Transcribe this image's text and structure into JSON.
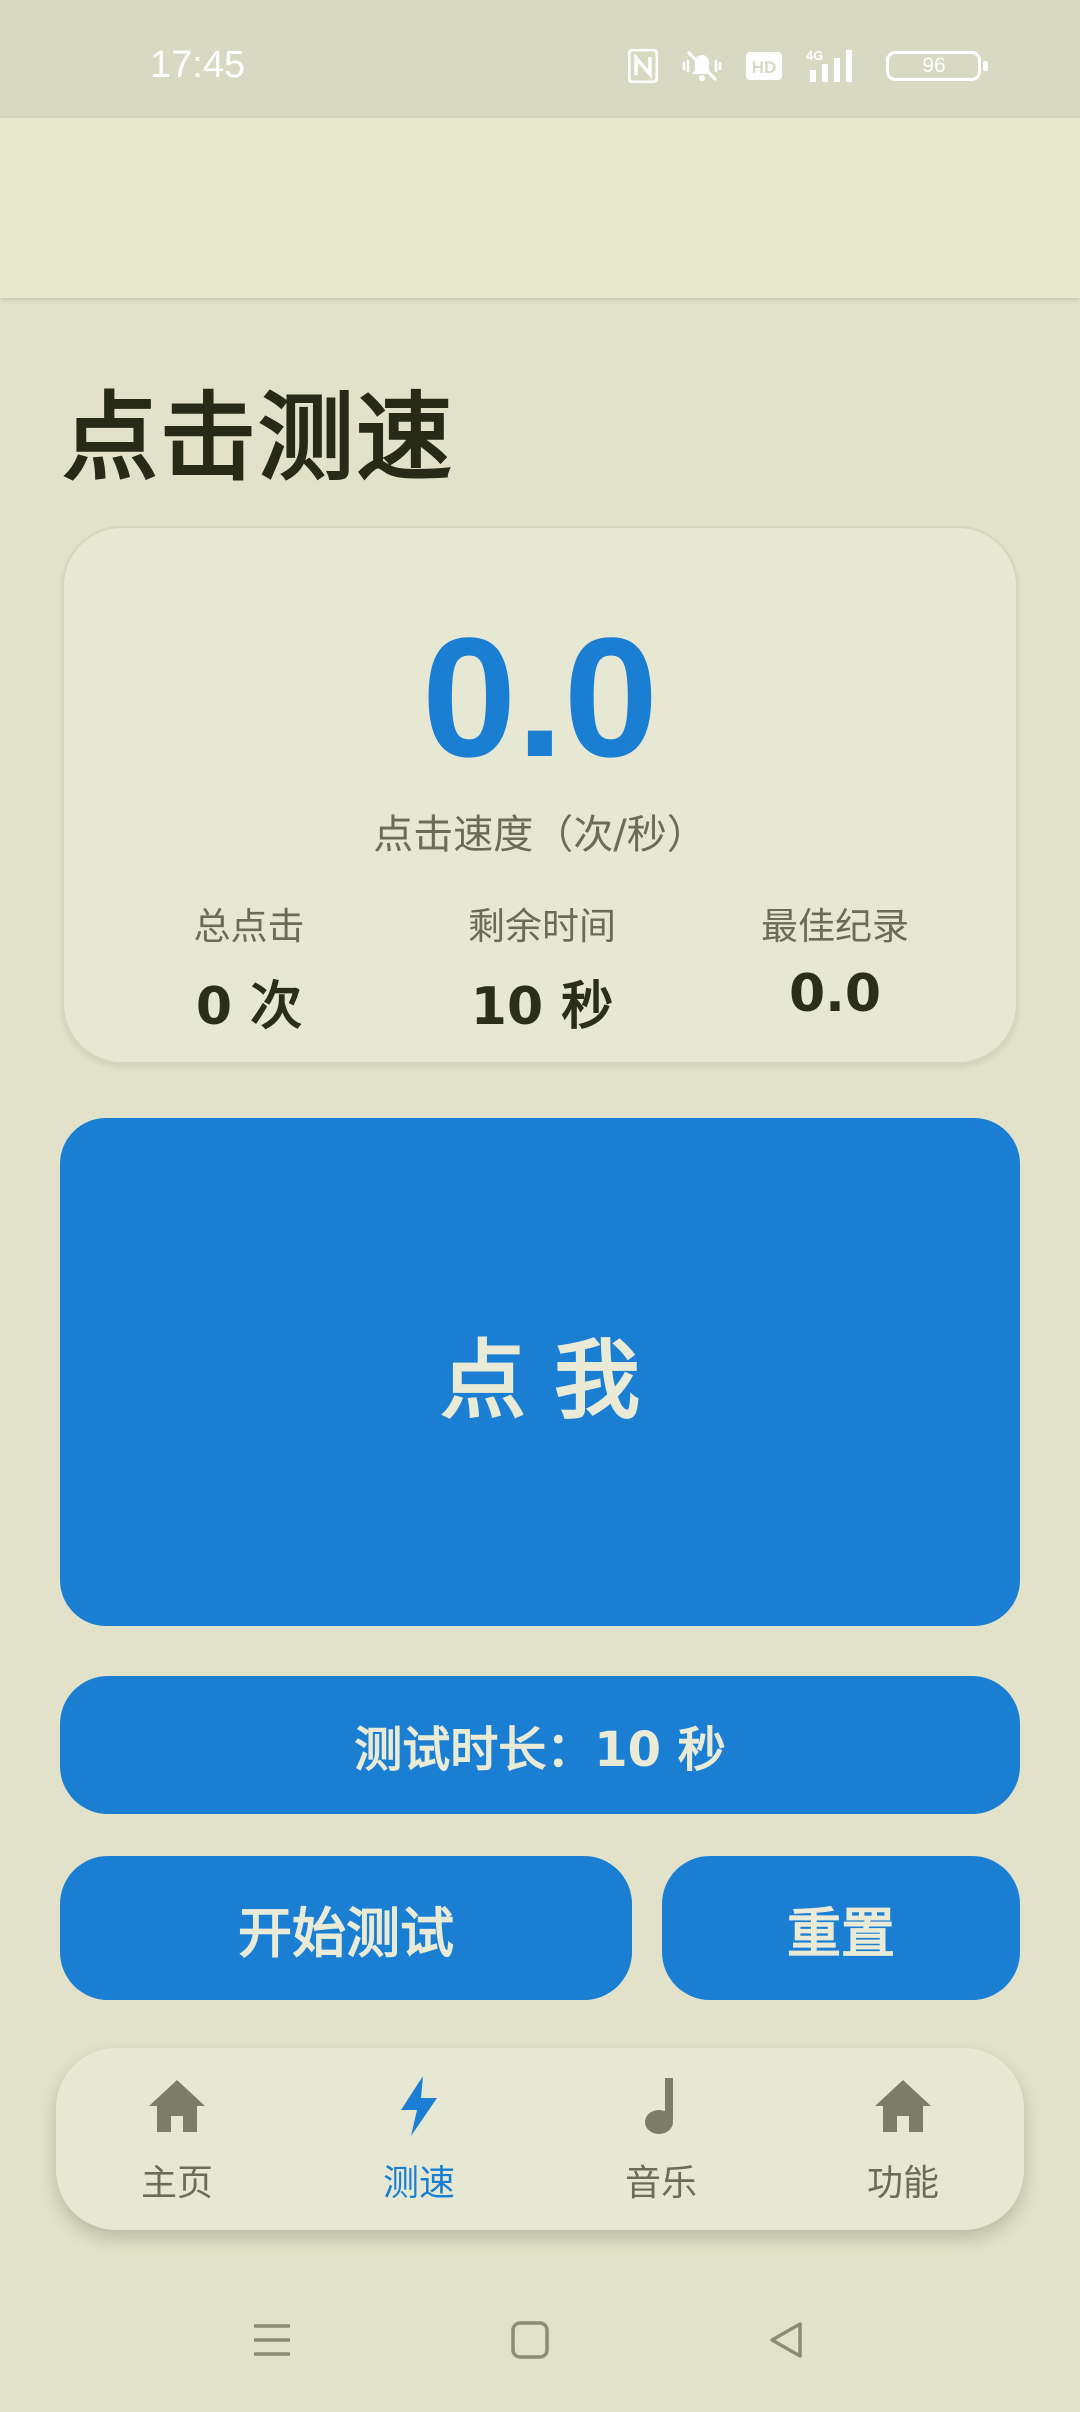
{
  "status_bar": {
    "time": "17:45",
    "battery": "96",
    "network": "4G",
    "hd_badge": "HD",
    "icons": [
      "nfc-icon",
      "silent-icon",
      "hd-icon",
      "signal-icon",
      "battery-icon"
    ]
  },
  "page": {
    "title": "点击测速"
  },
  "stats": {
    "speed_value": "0.0",
    "speed_label": "点击速度（次/秒）",
    "total_label": "总点击",
    "total_value": "0 次",
    "remaining_label": "剩余时间",
    "remaining_value": "10 秒",
    "best_label": "最佳纪录",
    "best_value": "0.0"
  },
  "actions": {
    "tap_label": "点我",
    "duration_label": "测试时长：10 秒",
    "start_label": "开始测试",
    "reset_label": "重置"
  },
  "bottom_nav": {
    "items": [
      {
        "label": "主页",
        "icon": "home-icon",
        "active": false
      },
      {
        "label": "测速",
        "icon": "bolt-icon",
        "active": true
      },
      {
        "label": "音乐",
        "icon": "music-note-icon",
        "active": false
      },
      {
        "label": "功能",
        "icon": "home-icon",
        "active": false
      }
    ]
  },
  "colors": {
    "accent": "#1a7ed3",
    "background": "#e1e2c9",
    "surface": "#e7e8d3",
    "inactive": "#6a6c58"
  }
}
